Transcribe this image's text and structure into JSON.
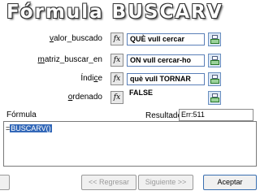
{
  "title": "Fórmula BUSCARV",
  "arguments": [
    {
      "label": "valor_buscado",
      "accel": "v",
      "fx": "fx",
      "value": "QUÈ vull cercar"
    },
    {
      "label": "matriz_buscar_en",
      "accel": "m",
      "fx": "fx",
      "value": "ON vull cercar-ho"
    },
    {
      "label": "Índice",
      "accel": "c",
      "fx": "fx",
      "value": "què vull TORNAR"
    },
    {
      "label": "ordenado",
      "accel": "o",
      "fx": "fx",
      "value": "FALSE"
    }
  ],
  "formula": {
    "label": "Fórmula",
    "prefix": "=",
    "selected": "BUSCARV()"
  },
  "result": {
    "label": "Resultado",
    "value": "Err:511"
  },
  "buttons": {
    "left": "",
    "back": "<< Regresar",
    "next": "Siguiente >>",
    "accept": "Aceptar"
  }
}
